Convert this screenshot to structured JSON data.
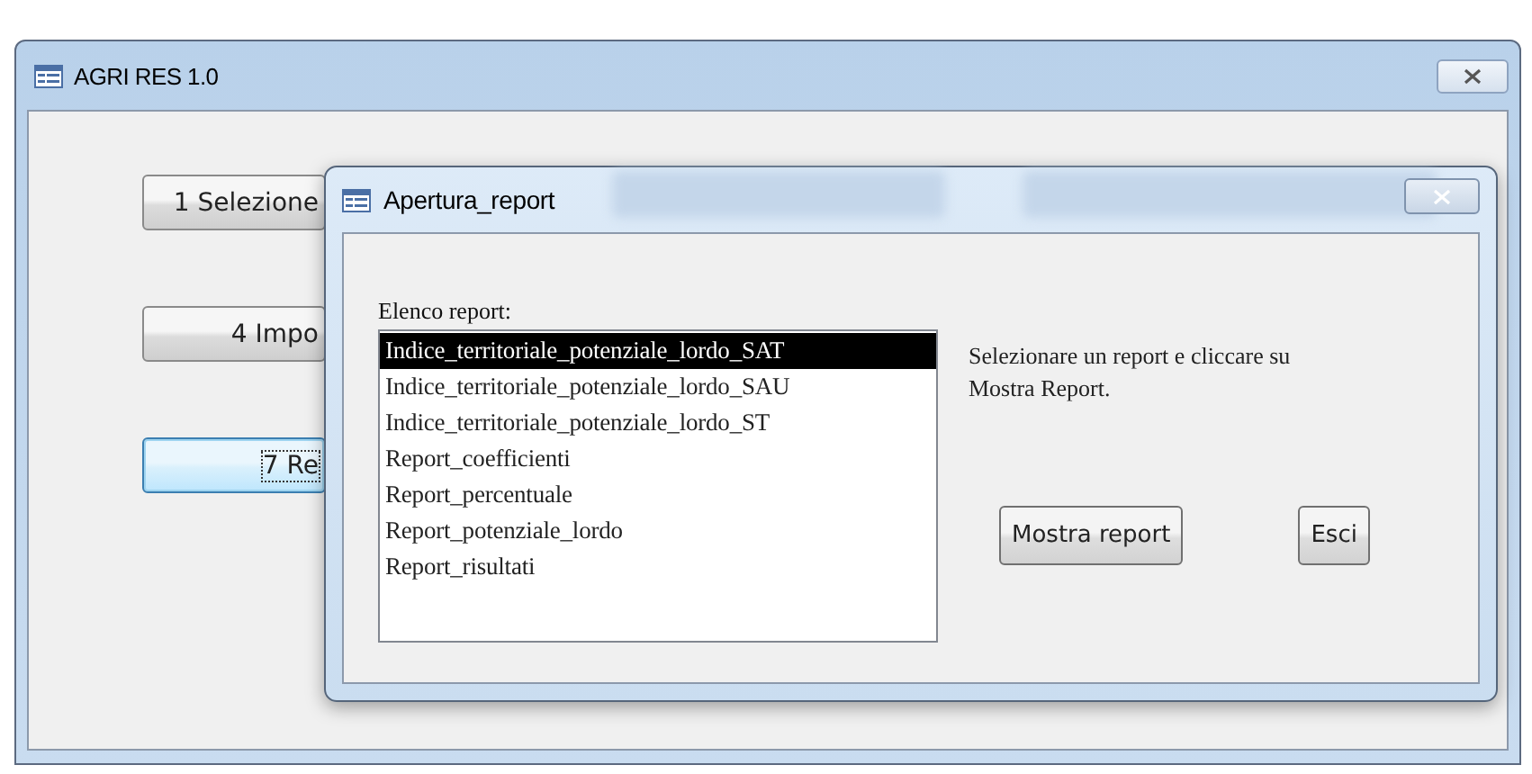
{
  "main_window": {
    "title": "AGRI RES 1.0",
    "buttons": [
      {
        "label": "1 Selezione",
        "focused": false
      },
      {
        "label": "4 Impo",
        "focused": false
      },
      {
        "label": "7 Re",
        "focused": true
      }
    ]
  },
  "dialog": {
    "title": "Apertura_report",
    "list_label": "Elenco report:",
    "reports": [
      {
        "label": "Indice_territoriale_potenziale_lordo_SAT",
        "selected": true
      },
      {
        "label": "Indice_territoriale_potenziale_lordo_SAU",
        "selected": false
      },
      {
        "label": "Indice_territoriale_potenziale_lordo_ST",
        "selected": false
      },
      {
        "label": "Report_coefficienti",
        "selected": false
      },
      {
        "label": "Report_percentuale",
        "selected": false
      },
      {
        "label": "Report_potenziale_lordo",
        "selected": false
      },
      {
        "label": "Report_risultati",
        "selected": false
      }
    ],
    "hint": "Selezionare un report e cliccare su Mostra Report.",
    "buttons": [
      "Mostra report",
      "Esci"
    ]
  }
}
